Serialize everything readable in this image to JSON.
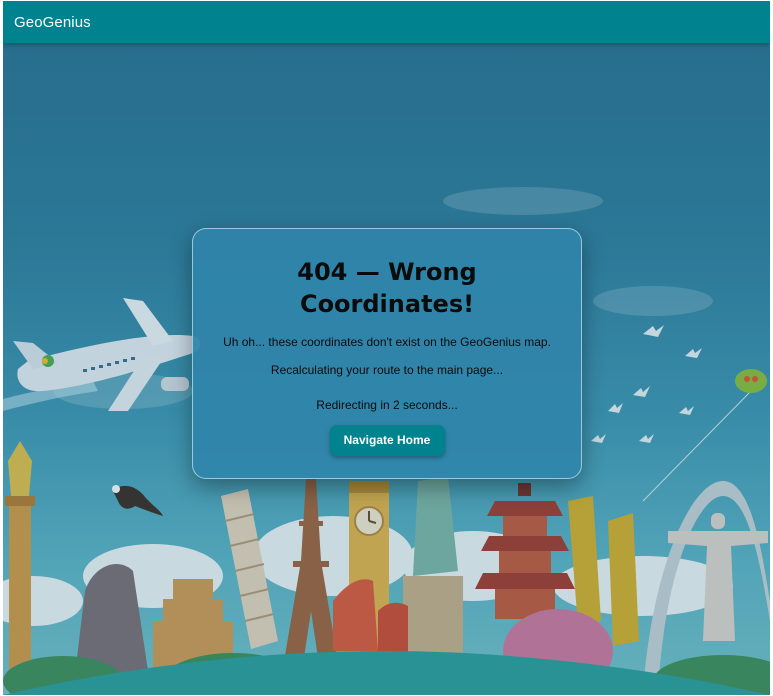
{
  "app": {
    "brand": "GeoGenius"
  },
  "card": {
    "title": "404 — Wrong Coordinates!",
    "message_line1": "Uh oh... these coordinates don't exist on the GeoGenius map.",
    "message_line2": "Recalculating your route to the main page...",
    "redirect_text": "Redirecting in 2 seconds...",
    "button_label": "Navigate Home"
  },
  "colors": {
    "topbar": "#00838f",
    "button": "#00838f",
    "card_bg": "#3084aa",
    "sky_top": "#2a6f90",
    "sky_bottom": "#77c4cc"
  }
}
